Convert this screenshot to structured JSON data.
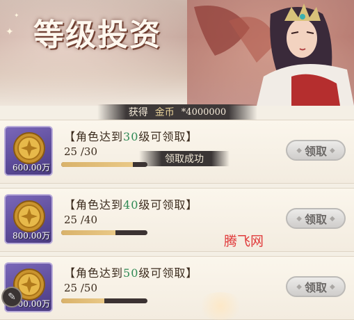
{
  "banner": {
    "title": "等级投资"
  },
  "reward": {
    "label": "获得",
    "currency": "金币",
    "amount": "*4000000"
  },
  "rows": [
    {
      "req_prefix": "【角色达到",
      "level": "30",
      "req_suffix": "级可领取】",
      "progress": "25 /30",
      "progress_fraction": 0.833,
      "item_amount": "600.00万",
      "claim_label": "领取"
    },
    {
      "req_prefix": "【角色达到",
      "level": "40",
      "req_suffix": "级可领取】",
      "progress": "25 /40",
      "progress_fraction": 0.625,
      "item_amount": "800.00万",
      "claim_label": "领取"
    },
    {
      "req_prefix": "【角色达到",
      "level": "50",
      "req_suffix": "级可领取】",
      "progress": "25 /50",
      "progress_fraction": 0.5,
      "item_amount": "00.00万",
      "claim_label": "领取"
    }
  ],
  "toast": "领取成功",
  "watermark": "腾飞网",
  "icons": {
    "coin": "gold-coin-icon",
    "corner": "edit-icon"
  },
  "colors": {
    "level_highlight": "#2f8a55",
    "item_frame": "#5c4b99",
    "progress_fill": "#d9b26a"
  }
}
